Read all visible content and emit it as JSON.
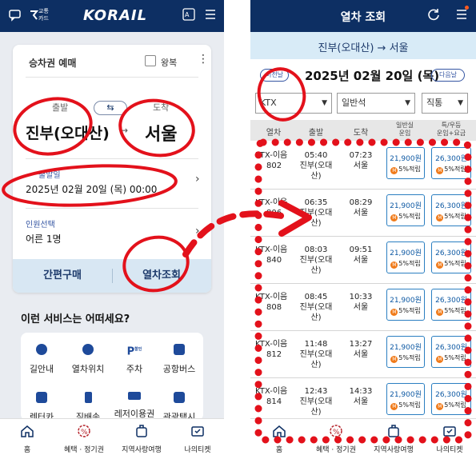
{
  "left_screen": {
    "header": {
      "chat_icon": "chat-icon",
      "badge_text_line1": "교통",
      "badge_text_line2": "카드",
      "logo": "KORAIL",
      "translate_icon": "translate-icon",
      "menu_icon": "menu-icon"
    },
    "booking_card": {
      "title": "승차권 예매",
      "roundtrip_label": "왕복",
      "departure_label": "출발",
      "arrival_label": "도착",
      "departure_station": "진부(오대산)",
      "arrival_station": "서울",
      "date_label": "출발일",
      "date_value": "2025년 02월 20일 (목) 00:00",
      "passenger_label": "인원선택",
      "passenger_value": "어른 1명",
      "easy_purchase_label": "간편구매",
      "train_search_label": "열차조회"
    },
    "services": {
      "title": "이런 서비스는 어떠세요?",
      "items": [
        {
          "label": "길안내",
          "icon": "navigation-icon"
        },
        {
          "label": "열차위치",
          "icon": "location-pin-icon"
        },
        {
          "label": "주차",
          "icon": "parking-icon",
          "badge": "할인"
        },
        {
          "label": "공항버스",
          "icon": "bus-icon"
        },
        {
          "label": "렌터카",
          "icon": "car-icon"
        },
        {
          "label": "짐배송",
          "icon": "luggage-icon"
        },
        {
          "label": "레저이용권",
          "icon": "ticket-icon"
        },
        {
          "label": "관광택시",
          "icon": "taxi-icon"
        }
      ]
    },
    "bottom_nav": [
      {
        "label": "홈",
        "icon": "home-icon"
      },
      {
        "label": "혜택 · 정기권",
        "icon": "discount-icon"
      },
      {
        "label": "지역사랑여행",
        "icon": "suitcase-icon"
      },
      {
        "label": "나의티켓",
        "icon": "ticket-icon"
      }
    ]
  },
  "right_screen": {
    "header": {
      "title": "열차 조회",
      "refresh_icon": "refresh-icon",
      "menu_icon": "menu-icon"
    },
    "route": "진부(오대산) → 서울",
    "date_nav": {
      "prev_label": "이전날",
      "date": "2025년 02월 20일 (목)",
      "next_label": "다음날"
    },
    "filters": {
      "train_type": "KTX",
      "seat_class": "일반석",
      "transfer": "직통"
    },
    "table": {
      "headers": {
        "train": "열차",
        "departure": "출발",
        "arrival": "도착",
        "standard_line1": "일반실",
        "standard_line2": "운임",
        "first_line1": "특/우등",
        "first_line2": "운임+요금"
      },
      "rows": [
        {
          "train": "KTX-이음",
          "no": "802",
          "dep_time": "05:40",
          "dep_station": "진부(오대산)",
          "arr_time": "07:23",
          "arr_station": "서울",
          "std_price": "21,900원",
          "std_mileage": "5%적립",
          "first_price": "26,300원",
          "first_mileage": "5%적립"
        },
        {
          "train": "KTX-이음",
          "no": "806",
          "dep_time": "06:35",
          "dep_station": "진부(오대산)",
          "arr_time": "08:29",
          "arr_station": "서울",
          "std_price": "21,900원",
          "std_mileage": "5%적립",
          "first_price": "26,300원",
          "first_mileage": "5%적립"
        },
        {
          "train": "KTX-이음",
          "no": "840",
          "dep_time": "08:03",
          "dep_station": "진부(오대산)",
          "arr_time": "09:51",
          "arr_station": "서울",
          "std_price": "21,900원",
          "std_mileage": "5%적립",
          "first_price": "26,300원",
          "first_mileage": "5%적립"
        },
        {
          "train": "KTX-이음",
          "no": "808",
          "dep_time": "08:45",
          "dep_station": "진부(오대산)",
          "arr_time": "10:33",
          "arr_station": "서울",
          "std_price": "21,900원",
          "std_mileage": "5%적립",
          "first_price": "26,300원",
          "first_mileage": "5%적립"
        },
        {
          "train": "KTX-이음",
          "no": "812",
          "dep_time": "11:48",
          "dep_station": "진부(오대산)",
          "arr_time": "13:27",
          "arr_station": "서울",
          "std_price": "21,900원",
          "std_mileage": "5%적립",
          "first_price": "26,300원",
          "first_mileage": "5%적립"
        },
        {
          "train": "KTX-이음",
          "no": "814",
          "dep_time": "12:43",
          "dep_station": "진부(오대산)",
          "arr_time": "14:33",
          "arr_station": "서울",
          "std_price": "21,900원",
          "std_mileage": "5%적립",
          "first_price": "26,300원",
          "first_mileage": "5%적립"
        }
      ]
    },
    "bottom_nav": [
      {
        "label": "홈",
        "icon": "home-icon"
      },
      {
        "label": "혜택 · 정기권",
        "icon": "discount-icon"
      },
      {
        "label": "지역사랑여행",
        "icon": "suitcase-icon"
      },
      {
        "label": "나의티켓",
        "icon": "ticket-icon"
      }
    ]
  },
  "colors": {
    "header_navy": "#0d2f63",
    "annotation_red": "#e3111b",
    "route_bar": "#d8ebf7",
    "fare_blue": "#2b7fc1",
    "mileage_orange": "#f07a19"
  }
}
